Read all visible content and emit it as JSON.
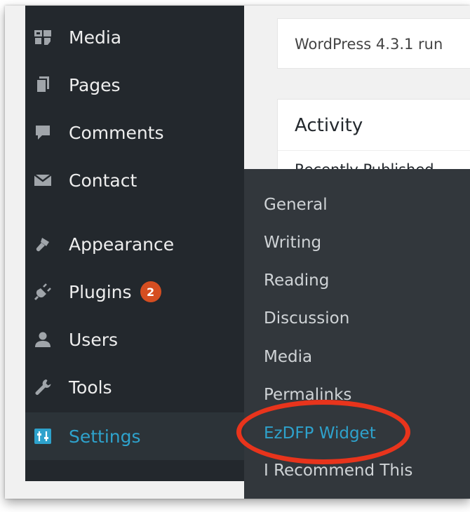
{
  "notice": {
    "text": "WordPress 4.3.1 run"
  },
  "activity": {
    "title": "Activity",
    "subtitle": "Recently Published"
  },
  "sidebar": {
    "items": [
      {
        "label": "Media",
        "icon": "media-icon"
      },
      {
        "label": "Pages",
        "icon": "pages-icon"
      },
      {
        "label": "Comments",
        "icon": "comments-icon"
      },
      {
        "label": "Contact",
        "icon": "envelope-icon"
      },
      {
        "label": "Appearance",
        "icon": "paintbrush-icon"
      },
      {
        "label": "Plugins",
        "icon": "plug-icon",
        "badge": "2"
      },
      {
        "label": "Users",
        "icon": "user-icon"
      },
      {
        "label": "Tools",
        "icon": "wrench-icon"
      },
      {
        "label": "Settings",
        "icon": "settings-icon",
        "active": true
      }
    ]
  },
  "settings_submenu": {
    "items": [
      {
        "label": "General"
      },
      {
        "label": "Writing"
      },
      {
        "label": "Reading"
      },
      {
        "label": "Discussion"
      },
      {
        "label": "Media"
      },
      {
        "label": "Permalinks"
      },
      {
        "label": "EzDFP Widget",
        "current": true
      },
      {
        "label": "I Recommend This"
      }
    ]
  },
  "colors": {
    "sidebar_bg": "#23282d",
    "submenu_bg": "#32373c",
    "accent": "#2ea2cc",
    "badge": "#d54e21",
    "highlight": "#e8341c"
  }
}
